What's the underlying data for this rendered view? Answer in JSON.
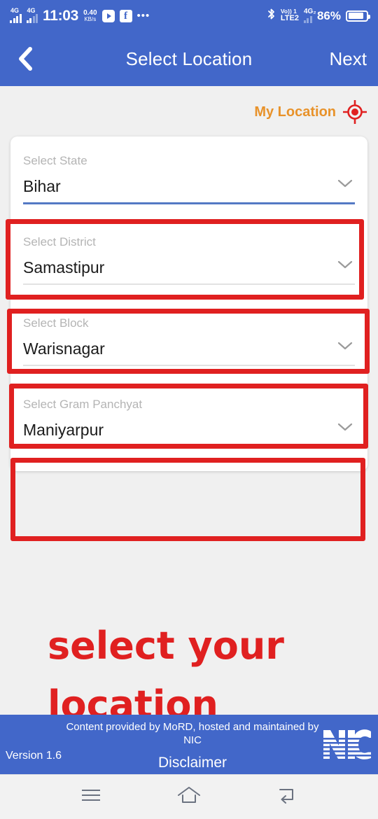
{
  "status_bar": {
    "signal_1_label": "4G",
    "signal_2_label": "4G",
    "clock": "11:03",
    "net_speed_value": "0.40",
    "net_speed_unit": "KB/s",
    "app_icon_1": "youtube-icon",
    "app_icon_2": "facebook-icon",
    "overflow": "•••",
    "bluetooth_icon": "bluetooth-icon",
    "volte_top": "Vo)) 1",
    "volte_bottom": "LTE2",
    "signal_3_label": "4G₂",
    "battery_percent": "86%"
  },
  "app_bar": {
    "back_icon": "chevron-left-icon",
    "title": "Select Location",
    "next_label": "Next"
  },
  "my_location": {
    "label": "My Location",
    "icon": "gps-crosshair-icon",
    "label_color": "#e8922a",
    "icon_color": "#e02020"
  },
  "form": {
    "fields": [
      {
        "placeholder": "Select State",
        "value": "Bihar",
        "underline": "active"
      },
      {
        "placeholder": "Select District",
        "value": "Samastipur",
        "underline": "idle"
      },
      {
        "placeholder": "Select Block",
        "value": "Warisnagar",
        "underline": "idle"
      },
      {
        "placeholder": "Select Gram Panchyat",
        "value": "Maniyarpur",
        "underline": "idle"
      }
    ],
    "chevron_icon": "chevron-down-icon",
    "active_underline_color": "#5479c4"
  },
  "annotation": {
    "text": "select your location",
    "color": "#e02020",
    "box_color": "#e02020",
    "box_count": 4
  },
  "footer": {
    "version": "Version 1.6",
    "credit": "Content provided by MoRD, hosted and maintained by NIC",
    "disclaimer": "Disclaimer",
    "logo": "NIC",
    "background": "#4267c9"
  },
  "nav_bar": {
    "recents_icon": "menu-icon",
    "home_icon": "home-icon",
    "back_icon": "back-arrow-icon"
  }
}
